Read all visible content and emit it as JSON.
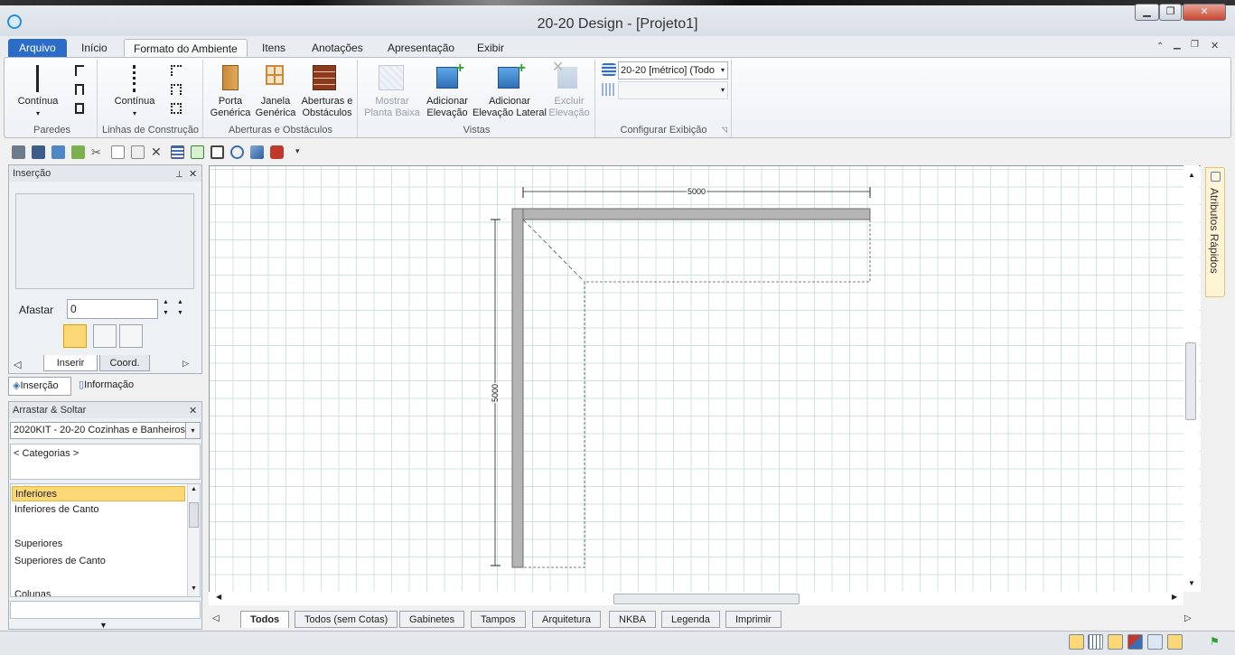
{
  "window": {
    "title": "20-20 Design - [Projeto1]",
    "min": "▁",
    "max": "❐",
    "close": "✕"
  },
  "ribbon": {
    "tabs": [
      "Arquivo",
      "Início",
      "Formato do Ambiente",
      "Itens",
      "Anotações",
      "Apresentação",
      "Exibir"
    ],
    "groups": {
      "paredes": {
        "label": "Paredes",
        "continua": "Contínua"
      },
      "linhas": {
        "label": "Linhas de Construção",
        "continua": "Contínua"
      },
      "aberturas": {
        "label": "Aberturas e Obstáculos",
        "porta": [
          "Porta",
          "Genérica"
        ],
        "janela": [
          "Janela",
          "Genérica"
        ],
        "aberturas": [
          "Aberturas e",
          "Obstáculos"
        ]
      },
      "vistas": {
        "label": "Vistas",
        "mostrar": [
          "Mostrar",
          "Planta Baixa"
        ],
        "adicionar": [
          "Adicionar",
          "Elevação"
        ],
        "lateral": [
          "Adicionar",
          "Elevação Lateral"
        ],
        "excluir": [
          "Excluir",
          "Elevação"
        ]
      },
      "config": {
        "label": "Configurar Exibição",
        "select1": "20-20 [métrico] (Todo",
        "select2": ""
      }
    }
  },
  "insercao": {
    "title": "Inserção",
    "afastar_label": "Afastar",
    "afastar_value": "0",
    "tabs": [
      "Inserir",
      "Coord."
    ],
    "subtabs": [
      "Inserção",
      "Informação"
    ]
  },
  "arrastar": {
    "title": "Arrastar & Soltar",
    "catalog": "2020KIT - 20-20 Cozinhas e Banheiros",
    "categorias": "< Categorias >",
    "items": [
      "Inferiores",
      "Inferiores de Canto",
      "",
      "Superiores",
      "Superiores de Canto",
      "",
      "Colunas"
    ]
  },
  "drawing": {
    "dimension": "5000"
  },
  "side": {
    "atributos": "Atributos Rápidos"
  },
  "bottom_tabs": [
    "Todos",
    "Todos (sem Cotas)",
    "Gabinetes",
    "Tampos",
    "Arquitetura",
    "NKBA",
    "Legenda",
    "Imprimir"
  ],
  "colors": {
    "accent": "#2a6cc7",
    "highlight": "#fcd776",
    "wall": "#b4b4b4"
  }
}
